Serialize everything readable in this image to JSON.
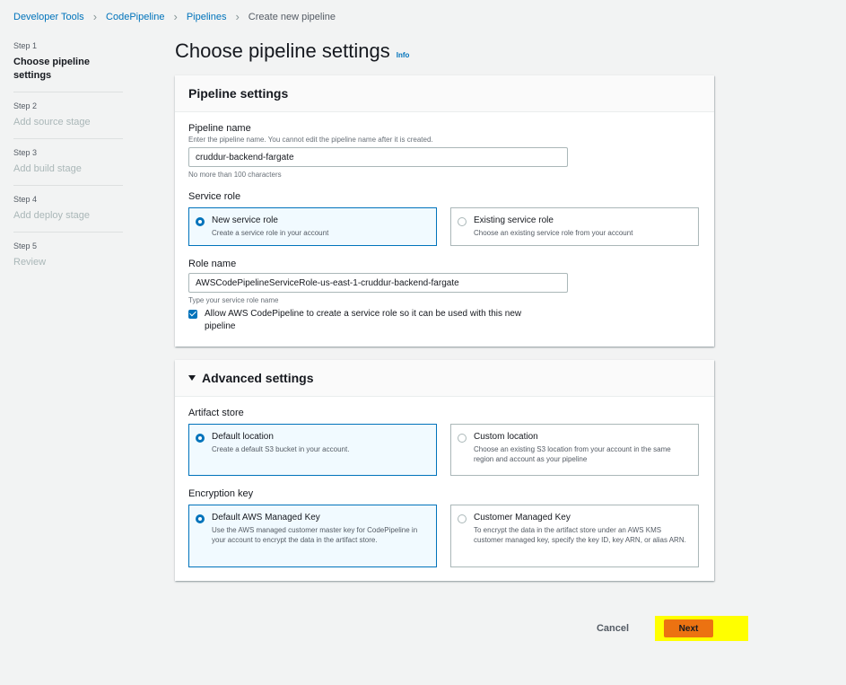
{
  "breadcrumb": {
    "items": [
      "Developer Tools",
      "CodePipeline",
      "Pipelines"
    ],
    "current": "Create new pipeline"
  },
  "steps": [
    {
      "num": "Step 1",
      "title": "Choose pipeline settings"
    },
    {
      "num": "Step 2",
      "title": "Add source stage"
    },
    {
      "num": "Step 3",
      "title": "Add build stage"
    },
    {
      "num": "Step 4",
      "title": "Add deploy stage"
    },
    {
      "num": "Step 5",
      "title": "Review"
    }
  ],
  "page": {
    "title": "Choose pipeline settings",
    "info": "Info"
  },
  "pipeline_settings": {
    "header": "Pipeline settings",
    "name_label": "Pipeline name",
    "name_desc": "Enter the pipeline name. You cannot edit the pipeline name after it is created.",
    "name_value": "cruddur-backend-fargate",
    "name_hint": "No more than 100 characters",
    "service_role_label": "Service role",
    "new_role_title": "New service role",
    "new_role_desc": "Create a service role in your account",
    "existing_role_title": "Existing service role",
    "existing_role_desc": "Choose an existing service role from your account",
    "role_name_label": "Role name",
    "role_name_value": "AWSCodePipelineServiceRole-us-east-1-cruddur-backend-fargate",
    "role_name_hint": "Type your service role name",
    "allow_label": "Allow AWS CodePipeline to create a service role so it can be used with this new pipeline"
  },
  "advanced_settings": {
    "header": "Advanced settings",
    "artifact_label": "Artifact store",
    "default_location_title": "Default location",
    "default_location_desc": "Create a default S3 bucket in your account.",
    "custom_location_title": "Custom location",
    "custom_location_desc": "Choose an existing S3 location from your account in the same region and account as your pipeline",
    "encryption_label": "Encryption key",
    "default_key_title": "Default AWS Managed Key",
    "default_key_desc": "Use the AWS managed customer master key for CodePipeline in your account to encrypt the data in the artifact store.",
    "customer_key_title": "Customer Managed Key",
    "customer_key_desc": "To encrypt the data in the artifact store under an AWS KMS customer managed key, specify the key ID, key ARN, or alias ARN."
  },
  "footer": {
    "cancel": "Cancel",
    "next": "Next"
  },
  "colors": {
    "accent": "#0073bb",
    "primary_button": "#ec7211",
    "highlight": "#ffff00"
  }
}
